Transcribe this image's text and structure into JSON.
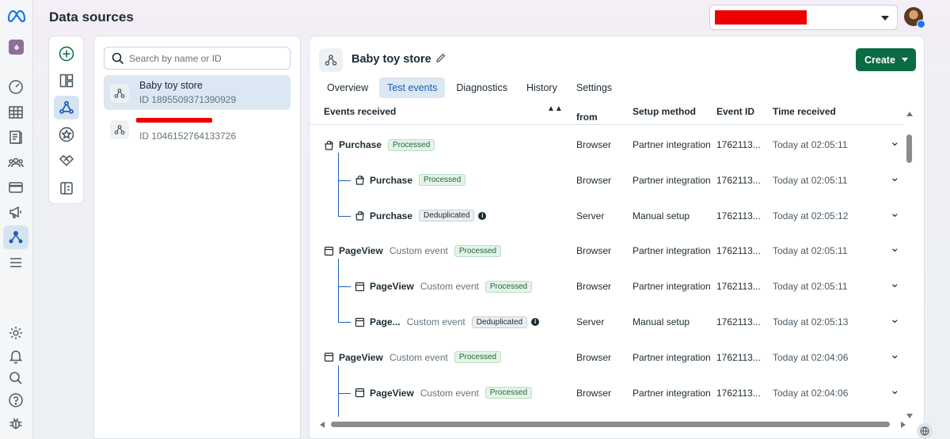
{
  "header": {
    "title": "Data sources"
  },
  "search": {
    "placeholder": "Search by name or ID"
  },
  "sources": [
    {
      "name": "Baby toy store",
      "id": "ID 1895509371390929",
      "selected": true
    },
    {
      "name": "",
      "id": "ID 1046152764133726",
      "selected": false
    }
  ],
  "detail": {
    "title": "Baby toy store",
    "create_label": "Create",
    "tabs": [
      "Overview",
      "Test events",
      "Diagnostics",
      "History",
      "Settings"
    ],
    "active_tab": "Test events"
  },
  "table": {
    "headers": {
      "events": "Events received",
      "from": "from",
      "setup": "Setup method",
      "event_id": "Event ID",
      "time": "Time received"
    },
    "rows": [
      {
        "name": "Purchase",
        "sub": "",
        "badge": "Processed",
        "badge_type": "proc",
        "info": false,
        "from": "Browser",
        "setup": "Partner integration",
        "event_id": "1762113...",
        "time": "Today at 02:05:11",
        "child": false,
        "icon": "shopping-bag-icon"
      },
      {
        "name": "Purchase",
        "sub": "",
        "badge": "Processed",
        "badge_type": "proc",
        "info": false,
        "from": "Browser",
        "setup": "Partner integration",
        "event_id": "1762113...",
        "time": "Today at 02:05:11",
        "child": true,
        "icon": "shopping-bag-icon"
      },
      {
        "name": "Purchase",
        "sub": "",
        "badge": "Deduplicated",
        "badge_type": "dedup",
        "info": true,
        "from": "Server",
        "setup": "Manual setup",
        "event_id": "1762113...",
        "time": "Today at 02:05:12",
        "child": true,
        "icon": "shopping-bag-icon"
      },
      {
        "name": "PageView",
        "sub": "Custom event",
        "badge": "Processed",
        "badge_type": "proc",
        "info": false,
        "from": "Browser",
        "setup": "Partner integration",
        "event_id": "1762113...",
        "time": "Today at 02:05:11",
        "child": false,
        "icon": "browser-window-icon"
      },
      {
        "name": "PageView",
        "sub": "Custom event",
        "badge": "Processed",
        "badge_type": "proc",
        "info": false,
        "from": "Browser",
        "setup": "Partner integration",
        "event_id": "1762113...",
        "time": "Today at 02:05:11",
        "child": true,
        "icon": "browser-window-icon"
      },
      {
        "name": "Page...",
        "sub": "Custom event",
        "badge": "Deduplicated",
        "badge_type": "dedup",
        "info": true,
        "from": "Server",
        "setup": "Manual setup",
        "event_id": "1762113...",
        "time": "Today at 02:05:13",
        "child": true,
        "icon": "browser-window-icon"
      },
      {
        "name": "PageView",
        "sub": "Custom event",
        "badge": "Processed",
        "badge_type": "proc",
        "info": false,
        "from": "Browser",
        "setup": "Partner integration",
        "event_id": "1762113...",
        "time": "Today at 02:04:06",
        "child": false,
        "icon": "browser-window-icon"
      },
      {
        "name": "PageView",
        "sub": "Custom event",
        "badge": "Processed",
        "badge_type": "proc",
        "info": false,
        "from": "Browser",
        "setup": "Partner integration",
        "event_id": "1762113...",
        "time": "Today at 02:04:06",
        "child": true,
        "icon": "browser-window-icon"
      }
    ]
  },
  "colors": {
    "accent": "#1b5fb6",
    "create_button": "#0a6b45",
    "selected_bg": "#dbe7f3",
    "redaction": "#ee0000"
  }
}
